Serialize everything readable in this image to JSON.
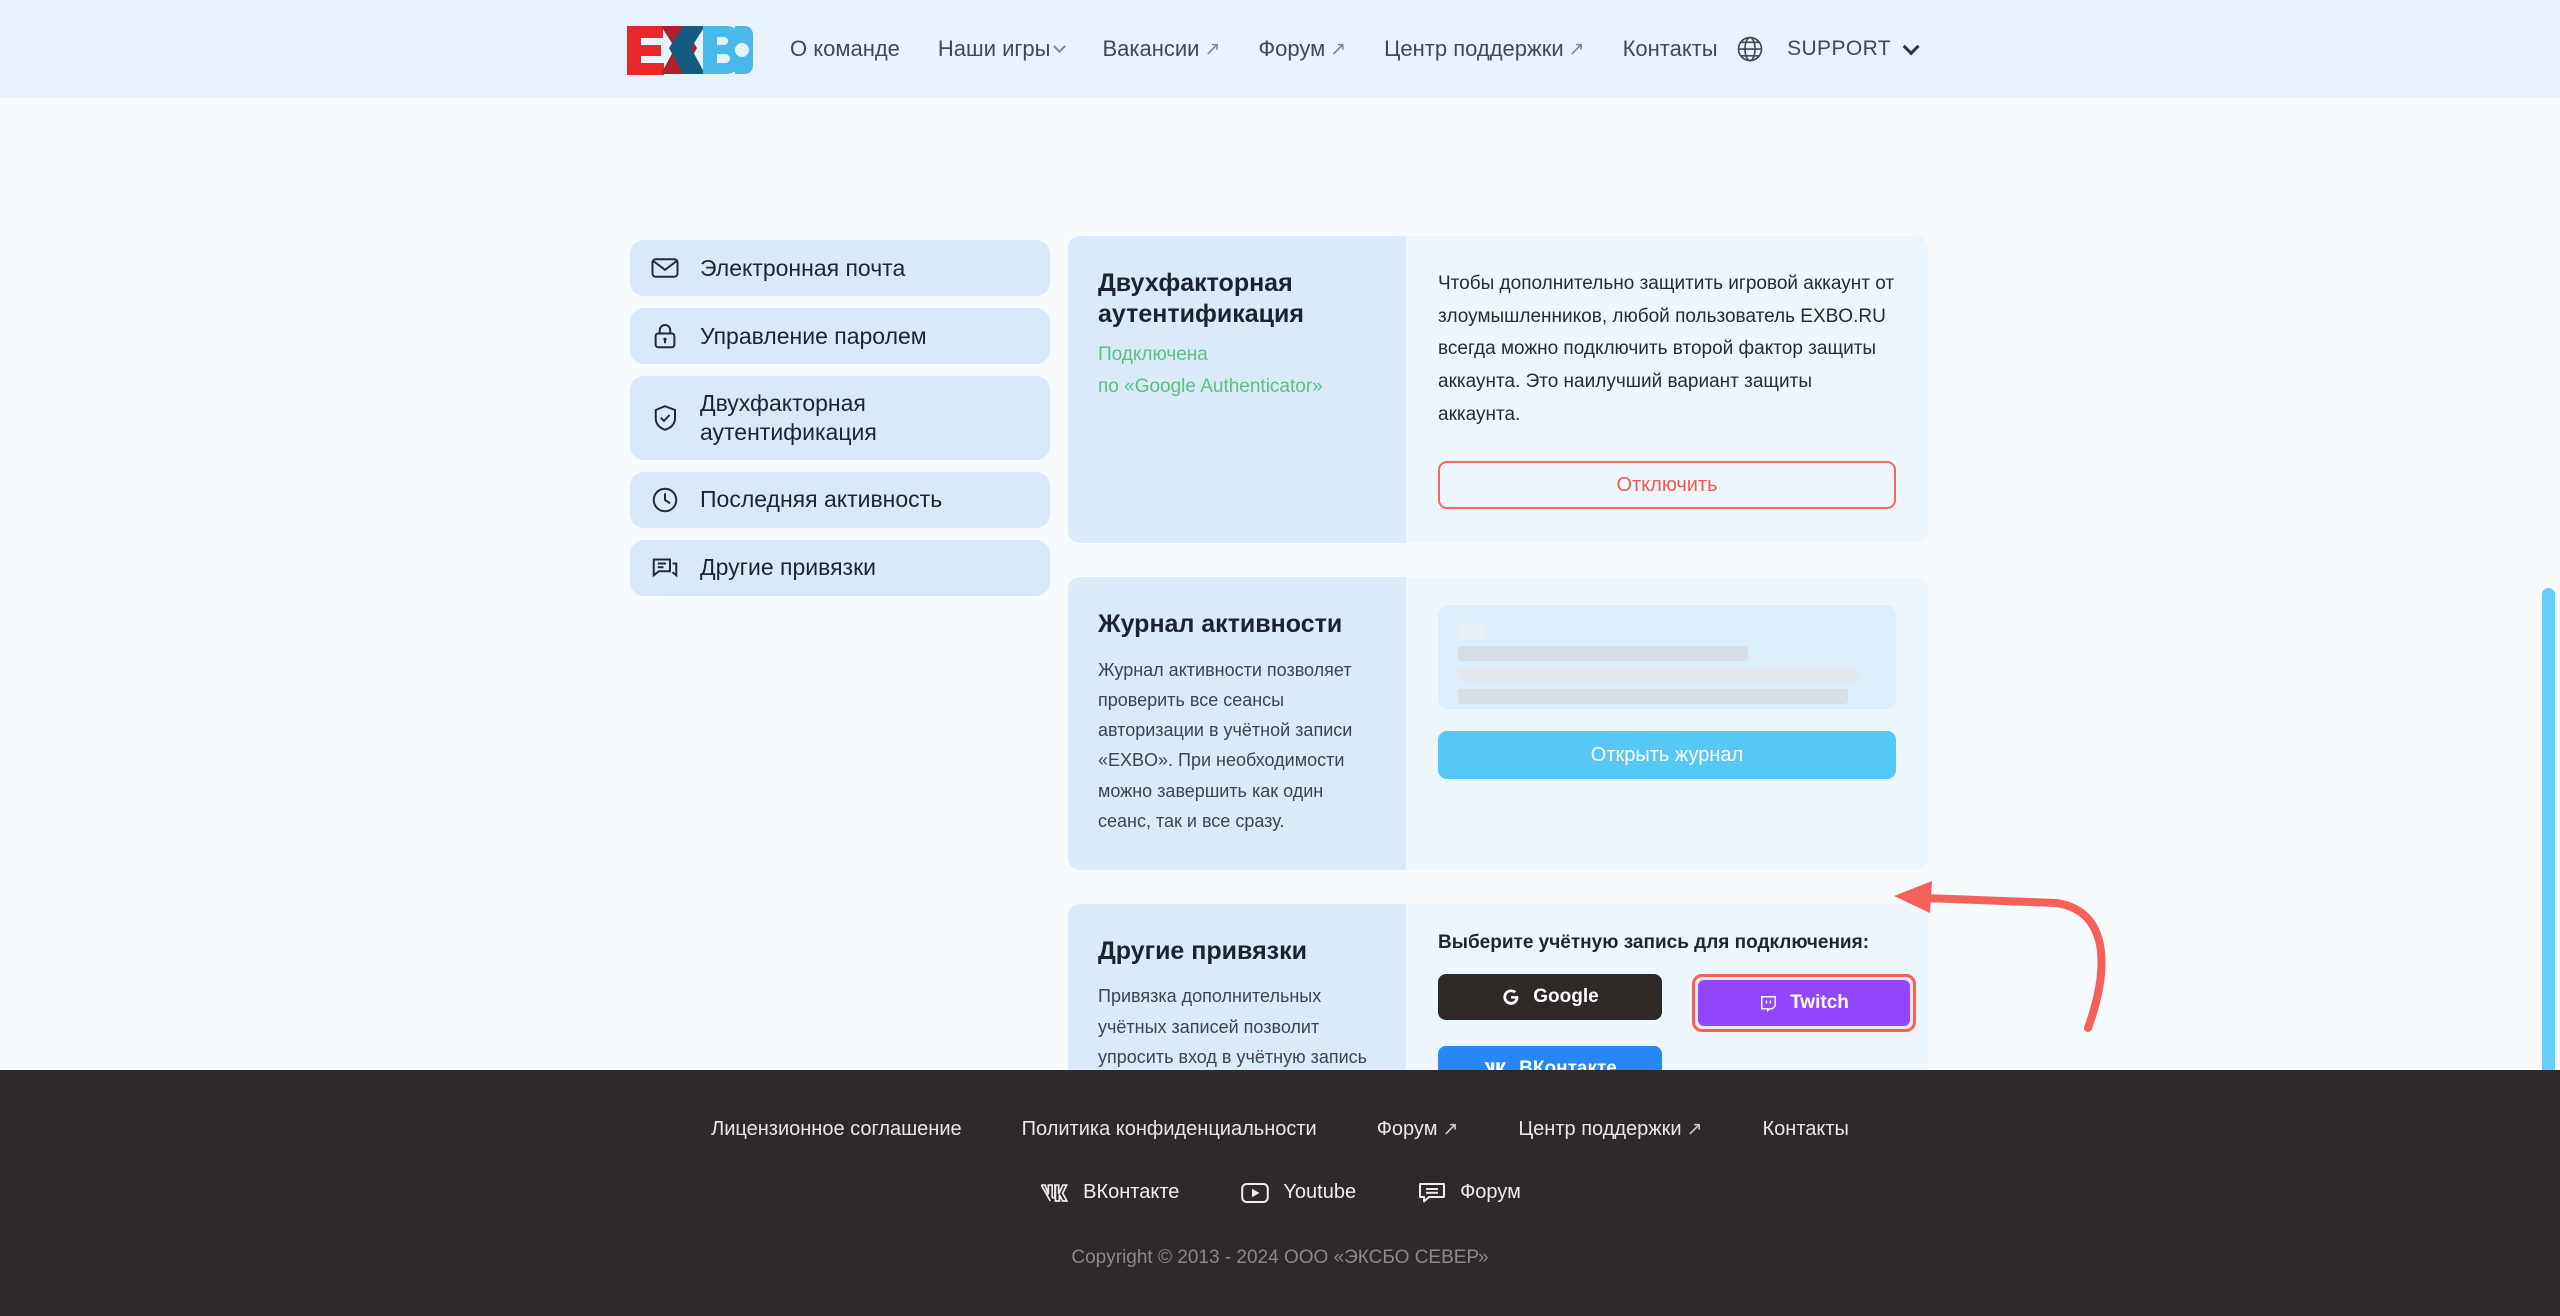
{
  "header": {
    "logo_text": "EXBO",
    "nav": [
      {
        "label": "О команде",
        "icon": "none"
      },
      {
        "label": "Наши игры",
        "icon": "chevron-down-icon"
      },
      {
        "label": "Вакансии",
        "icon": "external-link-icon"
      },
      {
        "label": "Форум",
        "icon": "external-link-icon"
      },
      {
        "label": "Центр поддержки",
        "icon": "external-link-icon"
      },
      {
        "label": "Контакты",
        "icon": "none"
      }
    ],
    "language_icon": "globe-icon",
    "support_label": "SUPPORT",
    "support_chevron": "chevron-down-icon"
  },
  "sidebar": {
    "items": [
      {
        "label": "Электронная почта",
        "icon": "envelope-icon"
      },
      {
        "label": "Управление паролем",
        "icon": "lock-icon"
      },
      {
        "label": "Двухфакторная аутентификация",
        "icon": "shield-check-icon"
      },
      {
        "label": "Последняя активность",
        "icon": "clock-icon"
      },
      {
        "label": "Другие привязки",
        "icon": "chat-icon"
      }
    ]
  },
  "cards": {
    "two_factor": {
      "title": "Двухфакторная аутентификация",
      "status_line1": "Подключена",
      "status_line2": "по «Google Authenticator»",
      "status_color": "#5ac27f",
      "body": "Чтобы дополнительно защитить игровой аккаунт от злоумышленников, любой пользователь EXBO.RU всегда можно подключить второй фактор защиты аккаунта. Это наилучший вариант защиты аккаунта.",
      "action_label": "Отключить",
      "action_color": "#ef5a50"
    },
    "activity_log": {
      "title": "Журнал активности",
      "body": "Журнал активности позволяет проверить все сеансы авторизации в учётной записи «EXBO». При необходимости можно завершить как один сеанс, так и все сразу.",
      "action_label": "Открыть журнал",
      "action_color": "#55c8f7",
      "redacted": true
    },
    "other_links": {
      "title": "Другие привязки",
      "body": "Привязка дополнительных учётных записей позволит упросить вход в учётную запись «EXBO», а также даст возможность получать бонусы при проведении различных событий.",
      "choose_label": "Выберите учётную запись для подключения:",
      "providers": [
        {
          "label": "Google",
          "icon": "google-icon",
          "color": "#2e2926",
          "highlighted": false
        },
        {
          "label": "Twitch",
          "icon": "twitch-icon",
          "color": "#9146ff",
          "highlighted": true
        },
        {
          "label": "ВКонтакте",
          "icon": "vk-icon",
          "color": "#2787f5",
          "highlighted": false
        }
      ]
    }
  },
  "annotation": {
    "arrow_color": "#f4615a",
    "points_to": "Twitch"
  },
  "footer": {
    "links": [
      {
        "label": "Лицензионное соглашение",
        "icon": "none"
      },
      {
        "label": "Политика конфиденциальности",
        "icon": "none"
      },
      {
        "label": "Форум",
        "icon": "external-link-icon"
      },
      {
        "label": "Центр поддержки",
        "icon": "external-link-icon"
      },
      {
        "label": "Контакты",
        "icon": "none"
      }
    ],
    "social": [
      {
        "label": "ВКонтакте",
        "icon": "vk-icon"
      },
      {
        "label": "Youtube",
        "icon": "youtube-icon"
      },
      {
        "label": "Форум",
        "icon": "forum-icon"
      }
    ],
    "copyright": "Copyright © 2013 - 2024 ООО «ЭКСБО СЕВЕР»"
  }
}
